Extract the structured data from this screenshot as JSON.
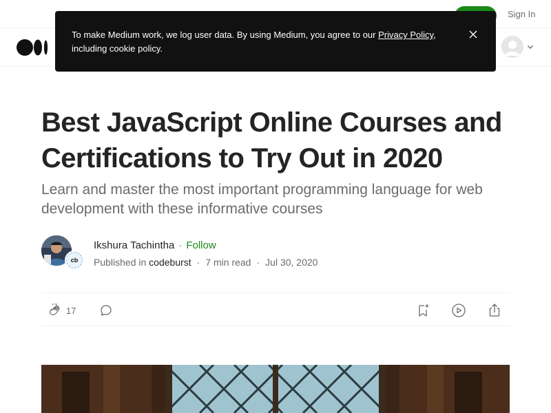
{
  "header": {
    "signup_label": "",
    "signin_label": "Sign In"
  },
  "cookie_banner": {
    "text_before_link": "To make Medium work, we log user data. By using Medium, you agree to our ",
    "link_text": "Privacy Policy,",
    "text_after_link": " including cookie policy."
  },
  "article": {
    "title": "Best JavaScript Online Courses and Certifications to Try Out in 2020",
    "subtitle": "Learn and master the most important programming language for web development with these informative courses"
  },
  "author": {
    "name": "Ikshura Tachintha",
    "separator": "·",
    "follow_label": "Follow",
    "publication_badge": "cb"
  },
  "meta": {
    "published_in": "Published in",
    "publication": "codeburst",
    "read_time": "7 min read",
    "date": "Jul 30, 2020",
    "separator": "·"
  },
  "actions": {
    "clap_count": "17"
  },
  "colors": {
    "accent_green": "#1a8917",
    "banner_bg": "#111111",
    "muted_text": "#6b6b6b"
  },
  "icons": {
    "logo": "medium-logo-icon",
    "close": "close-icon",
    "avatar": "user-avatar-icon",
    "chevron": "chevron-down-icon",
    "clap": "clap-icon",
    "comment": "comment-icon",
    "bookmark": "bookmark-add-icon",
    "listen": "play-icon",
    "share": "share-icon"
  }
}
